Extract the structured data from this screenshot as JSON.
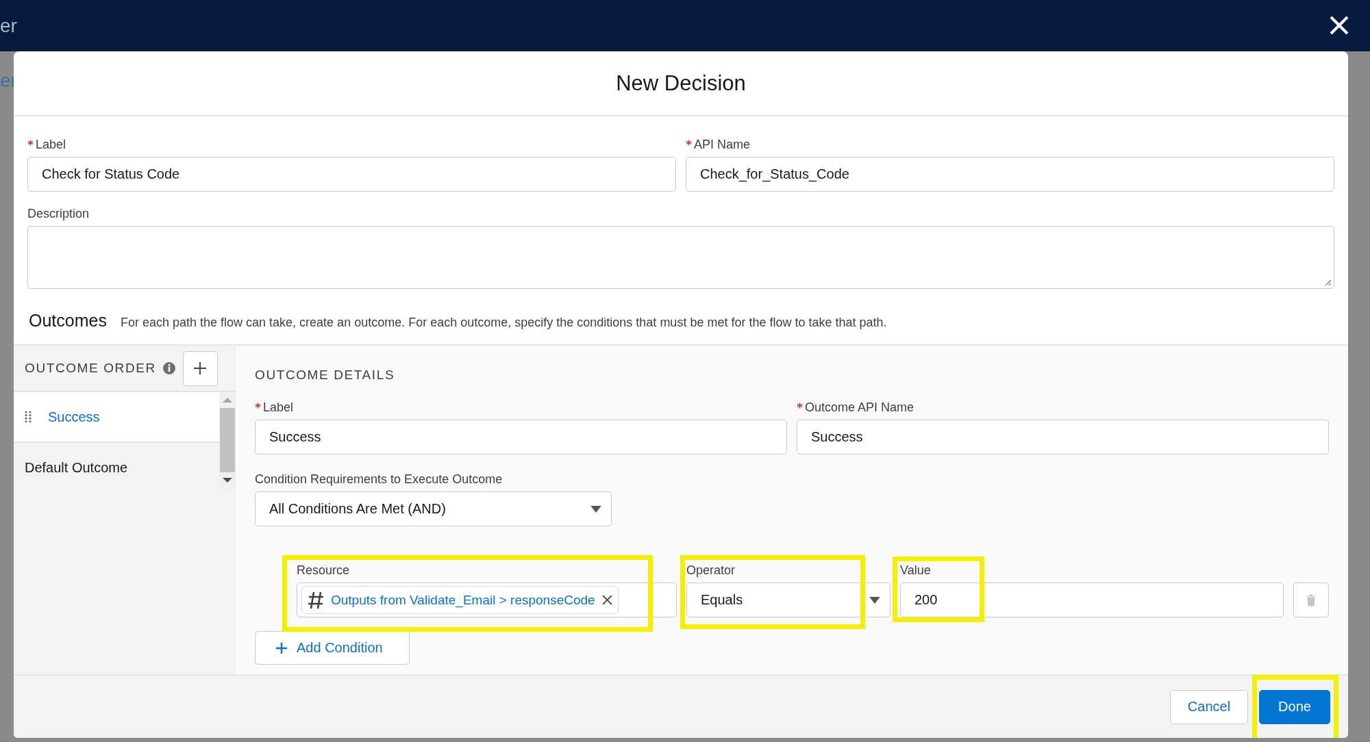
{
  "backdrop": {
    "header_fragment": "er",
    "tab_fragment": "er"
  },
  "modal": {
    "title": "New Decision"
  },
  "fields": [
    {
      "label": "Label",
      "required": true,
      "value": "Check for Status Code"
    },
    {
      "label": "API Name",
      "required": true,
      "value": "Check_for_Status_Code"
    }
  ],
  "description": {
    "label": "Description"
  },
  "outcomes": {
    "heading": "Outcomes",
    "help": "For each path the flow can take, create an outcome. For each outcome, specify the conditions that must be met for the flow to take that path."
  },
  "outcome_order": {
    "heading": "OUTCOME ORDER",
    "items": [
      {
        "label": "Success",
        "kind": "outcome",
        "selected": true
      },
      {
        "label": "Default Outcome",
        "kind": "default",
        "selected": false
      }
    ]
  },
  "outcome_details": {
    "heading": "OUTCOME DETAILS",
    "fields": [
      {
        "label": "Label",
        "required": true,
        "value": "Success"
      },
      {
        "label": "Outcome API Name",
        "required": true,
        "value": "Success"
      }
    ],
    "condition_requirements": {
      "label": "Condition Requirements to Execute Outcome",
      "value": "All Conditions Are Met (AND)"
    },
    "conditions": [
      {
        "resource": {
          "label": "Resource",
          "value": "Outputs from Validate_Email > responseCode",
          "highlighted": true
        },
        "operator": {
          "label": "Operator",
          "value": "Equals",
          "highlighted": true
        },
        "value": {
          "label": "Value",
          "value": "200",
          "highlighted": true
        }
      }
    ],
    "add_condition": "Add Condition"
  },
  "footer": {
    "buttons": [
      {
        "label": "Cancel",
        "kind": "neutral",
        "highlighted": false
      },
      {
        "label": "Done",
        "kind": "brand",
        "highlighted": true
      }
    ]
  }
}
